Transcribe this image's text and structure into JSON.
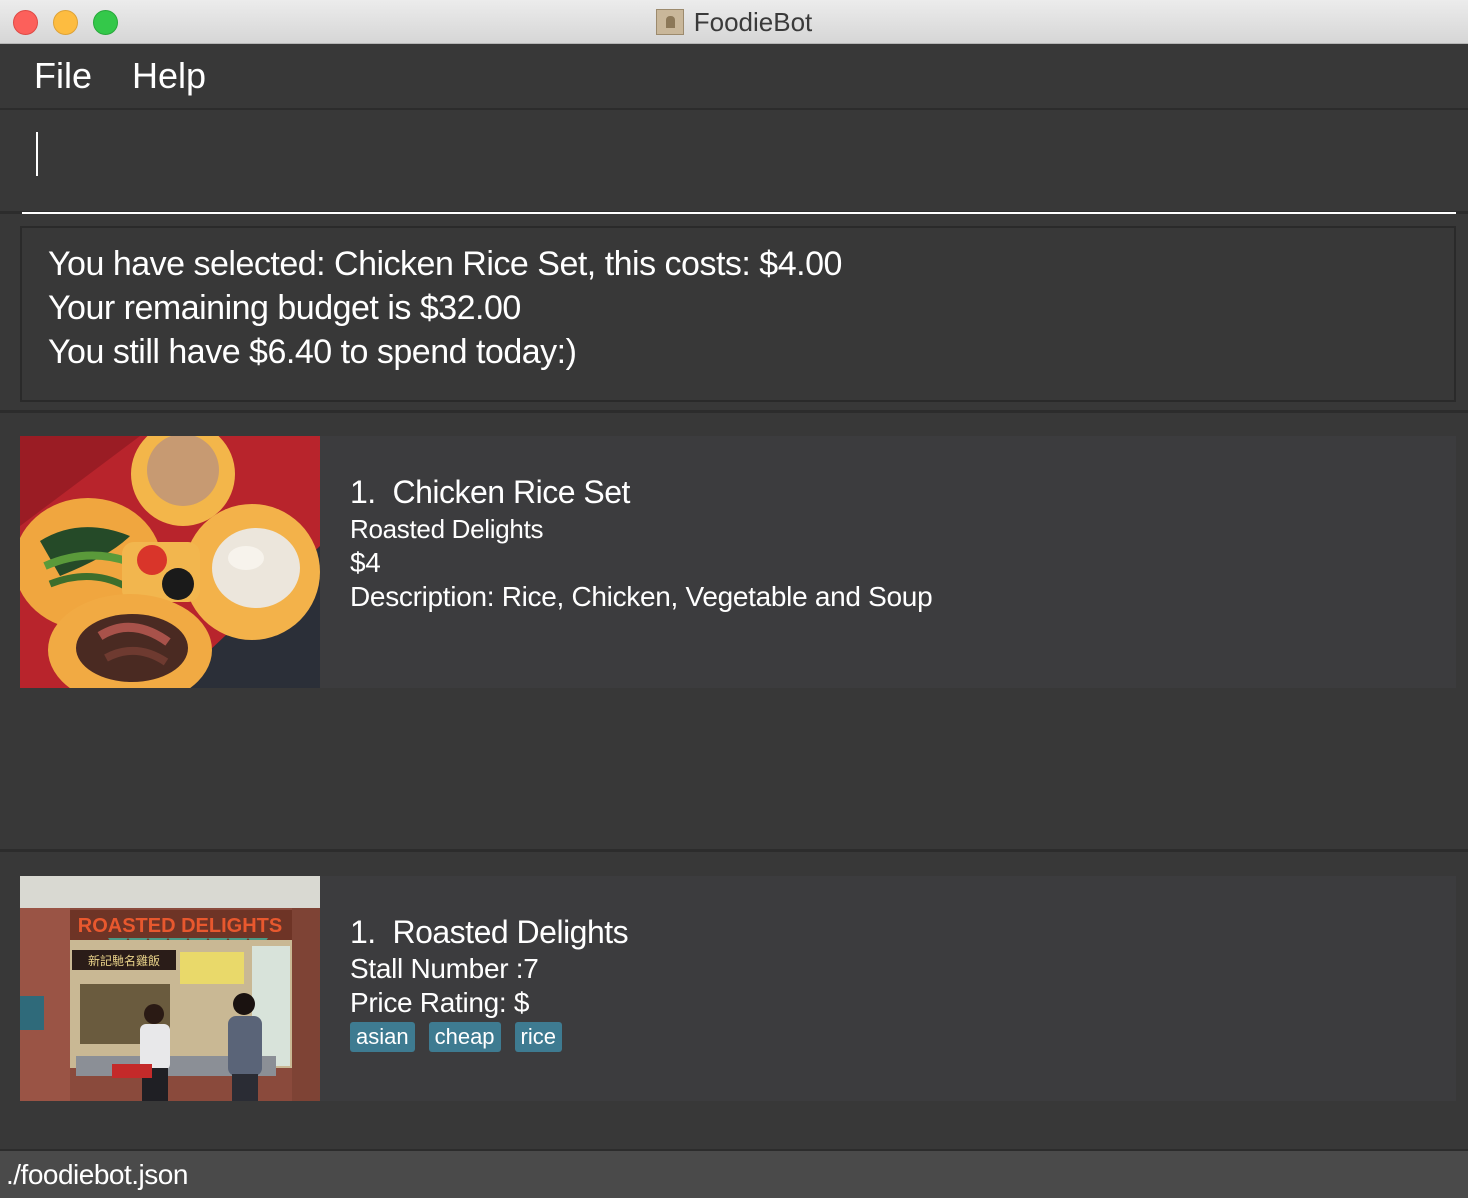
{
  "window": {
    "title": "FoodieBot"
  },
  "menu": {
    "items": [
      "File",
      "Help"
    ]
  },
  "command": {
    "value": "",
    "placeholder": ""
  },
  "result": {
    "lines": [
      "You have selected: Chicken Rice Set, this costs: $4.00",
      "Your remaining budget is $32.00",
      "You still have $6.40 to spend today:)"
    ]
  },
  "food_list": [
    {
      "index": "1.",
      "name": "Chicken Rice Set",
      "stall": "Roasted Delights",
      "price": "$4",
      "description": "Description: Rice, Chicken, Vegetable and Soup"
    }
  ],
  "stall_list": [
    {
      "index": "1.",
      "name": "Roasted Delights",
      "stall_number": "Stall Number :7",
      "price_rating": "Price Rating: $",
      "tags": [
        "asian",
        "cheap",
        "rice"
      ],
      "sign_text": "ROASTED DELIGHTS",
      "sign_chinese": "新記馳名雞飯"
    }
  ],
  "status": {
    "path": "./foodiebot.json"
  },
  "colors": {
    "background": "#383838",
    "card": "#3c3c3e",
    "tag": "#3e7b91"
  }
}
